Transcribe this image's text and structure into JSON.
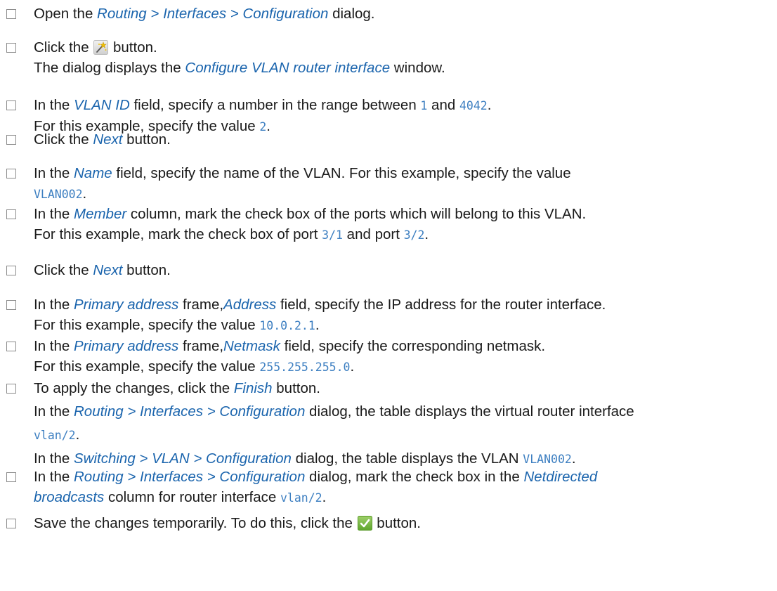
{
  "steps": [
    {
      "lines": [
        [
          {
            "t": "Open the "
          },
          {
            "t": "Routing > Interfaces > Configuration",
            "k": "ui"
          },
          {
            "t": " dialog."
          }
        ]
      ]
    },
    {
      "lines": [
        [
          {
            "t": "Click the "
          },
          {
            "icon": "wizard-icon"
          },
          {
            "t": " button."
          }
        ],
        [
          {
            "t": "The dialog displays the "
          },
          {
            "t": "Configure VLAN router interface",
            "k": "ui"
          },
          {
            "t": " window."
          }
        ]
      ]
    },
    {
      "lines": [
        [
          {
            "t": "In the "
          },
          {
            "t": "VLAN ID",
            "k": "ui"
          },
          {
            "t": " field, specify a number in the range between "
          },
          {
            "t": "1",
            "k": "mono"
          },
          {
            "t": " and "
          },
          {
            "t": "4042",
            "k": "mono"
          },
          {
            "t": "."
          }
        ],
        [
          {
            "t": "For this example, specify the value "
          },
          {
            "t": "2",
            "k": "mono"
          },
          {
            "t": "."
          }
        ]
      ]
    },
    {
      "lines": [
        [
          {
            "t": "Click the "
          },
          {
            "t": "Next",
            "k": "ui"
          },
          {
            "t": " button."
          }
        ]
      ]
    },
    {
      "lines": [
        [
          {
            "t": "In the "
          },
          {
            "t": "Name",
            "k": "ui"
          },
          {
            "t": " field, specify the name of the VLAN. For this example, specify the value"
          }
        ],
        [
          {
            "t": "VLAN002",
            "k": "mono"
          },
          {
            "t": "."
          }
        ]
      ]
    },
    {
      "lines": [
        [
          {
            "t": "In the "
          },
          {
            "t": "Member",
            "k": "ui"
          },
          {
            "t": " column, mark the check box of the ports which will belong to this VLAN."
          }
        ],
        [
          {
            "t": "For this example, mark the check box of port "
          },
          {
            "t": "3/1",
            "k": "mono"
          },
          {
            "t": " and port "
          },
          {
            "t": "3/2",
            "k": "mono"
          },
          {
            "t": "."
          }
        ]
      ]
    },
    {
      "lines": [
        [
          {
            "t": "Click the "
          },
          {
            "t": "Next",
            "k": "ui"
          },
          {
            "t": " button."
          }
        ]
      ]
    },
    {
      "lines": [
        [
          {
            "t": "In the "
          },
          {
            "t": "Primary address",
            "k": "ui"
          },
          {
            "t": " frame,"
          },
          {
            "t": "Address",
            "k": "ui"
          },
          {
            "t": " field, specify the IP address for the router interface."
          }
        ],
        [
          {
            "t": "For this example, specify the value "
          },
          {
            "t": "10.0.2.1",
            "k": "mono"
          },
          {
            "t": "."
          }
        ]
      ]
    },
    {
      "lines": [
        [
          {
            "t": "In the "
          },
          {
            "t": "Primary address",
            "k": "ui"
          },
          {
            "t": " frame,"
          },
          {
            "t": "Netmask",
            "k": "ui"
          },
          {
            "t": " field, specify the corresponding netmask."
          }
        ],
        [
          {
            "t": "For this example, specify the value "
          },
          {
            "t": "255.255.255.0",
            "k": "mono"
          },
          {
            "t": "."
          }
        ]
      ]
    },
    {
      "lines": [
        [
          {
            "t": "To apply the changes, click the "
          },
          {
            "t": "Finish",
            "k": "ui"
          },
          {
            "t": " button."
          }
        ],
        [
          {
            "t": "In the "
          },
          {
            "t": "Routing > Interfaces > Configuration",
            "k": "ui"
          },
          {
            "t": " dialog, the table displays the virtual router interface"
          }
        ],
        [
          {
            "t": "vlan/2",
            "k": "mono"
          },
          {
            "t": "."
          }
        ],
        [
          {
            "t": "In the "
          },
          {
            "t": "Switching > VLAN > Configuration",
            "k": "ui"
          },
          {
            "t": " dialog, the table displays the VLAN "
          },
          {
            "t": "VLAN002",
            "k": "mono"
          },
          {
            "t": "."
          }
        ]
      ]
    },
    {
      "lines": [
        [
          {
            "t": "In the "
          },
          {
            "t": "Routing > Interfaces > Configuration",
            "k": "ui"
          },
          {
            "t": " dialog, mark the check box in the "
          },
          {
            "t": "Netdirected",
            "k": "ui"
          }
        ],
        [
          {
            "t": "broadcasts",
            "k": "ui"
          },
          {
            "t": " column for router interface "
          },
          {
            "t": "vlan/2",
            "k": "mono"
          },
          {
            "t": "."
          }
        ]
      ]
    },
    {
      "lines": [
        [
          {
            "t": "Save the changes temporarily. To do this, click the "
          },
          {
            "icon": "checkmark-icon"
          },
          {
            "t": " button."
          }
        ]
      ]
    }
  ]
}
